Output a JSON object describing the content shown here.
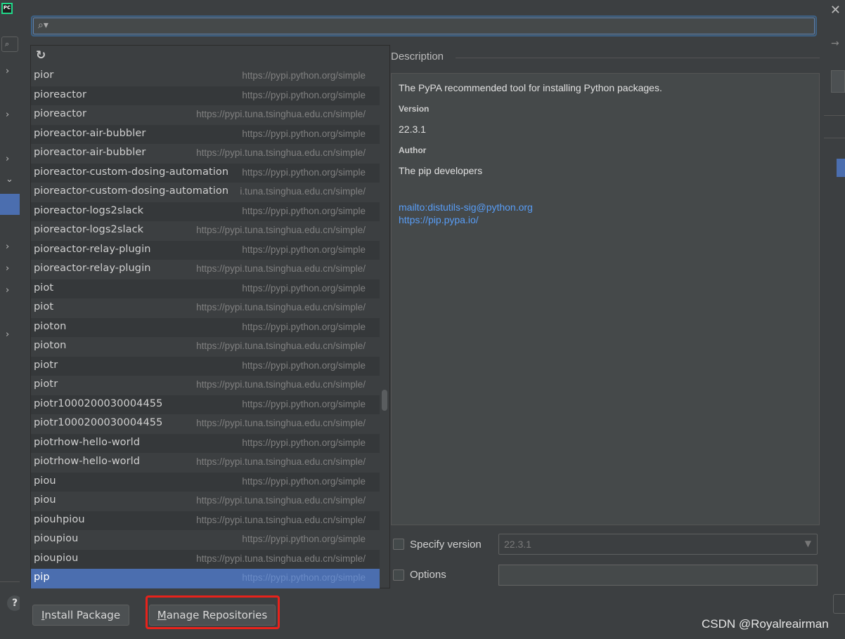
{
  "search": {
    "value": "",
    "icon": "search-icon"
  },
  "toolbar": {
    "refresh_icon": "refresh-icon"
  },
  "packages": [
    {
      "name": "pior",
      "repo": "https://pypi.python.org/simple"
    },
    {
      "name": "pioreactor",
      "repo": "https://pypi.python.org/simple"
    },
    {
      "name": "pioreactor",
      "repo": "https://pypi.tuna.tsinghua.edu.cn/simple/"
    },
    {
      "name": "pioreactor-air-bubbler",
      "repo": "https://pypi.python.org/simple"
    },
    {
      "name": "pioreactor-air-bubbler",
      "repo": "https://pypi.tuna.tsinghua.edu.cn/simple/"
    },
    {
      "name": "pioreactor-custom-dosing-automation",
      "repo": "https://pypi.python.org/simple"
    },
    {
      "name": "pioreactor-custom-dosing-automation",
      "repo": "i.tuna.tsinghua.edu.cn/simple/"
    },
    {
      "name": "pioreactor-logs2slack",
      "repo": "https://pypi.python.org/simple"
    },
    {
      "name": "pioreactor-logs2slack",
      "repo": "https://pypi.tuna.tsinghua.edu.cn/simple/"
    },
    {
      "name": "pioreactor-relay-plugin",
      "repo": "https://pypi.python.org/simple"
    },
    {
      "name": "pioreactor-relay-plugin",
      "repo": "https://pypi.tuna.tsinghua.edu.cn/simple/"
    },
    {
      "name": "piot",
      "repo": "https://pypi.python.org/simple"
    },
    {
      "name": "piot",
      "repo": "https://pypi.tuna.tsinghua.edu.cn/simple/"
    },
    {
      "name": "pioton",
      "repo": "https://pypi.python.org/simple"
    },
    {
      "name": "pioton",
      "repo": "https://pypi.tuna.tsinghua.edu.cn/simple/"
    },
    {
      "name": "piotr",
      "repo": "https://pypi.python.org/simple"
    },
    {
      "name": "piotr",
      "repo": "https://pypi.tuna.tsinghua.edu.cn/simple/"
    },
    {
      "name": "piotr1000200030004455",
      "repo": "https://pypi.python.org/simple"
    },
    {
      "name": "piotr1000200030004455",
      "repo": "https://pypi.tuna.tsinghua.edu.cn/simple/"
    },
    {
      "name": "piotrhow-hello-world",
      "repo": "https://pypi.python.org/simple"
    },
    {
      "name": "piotrhow-hello-world",
      "repo": "https://pypi.tuna.tsinghua.edu.cn/simple/"
    },
    {
      "name": "piou",
      "repo": "https://pypi.python.org/simple"
    },
    {
      "name": "piou",
      "repo": "https://pypi.tuna.tsinghua.edu.cn/simple/"
    },
    {
      "name": "piouhpiou",
      "repo": "https://pypi.tuna.tsinghua.edu.cn/simple/"
    },
    {
      "name": "pioupiou",
      "repo": "https://pypi.python.org/simple"
    },
    {
      "name": "pioupiou",
      "repo": "https://pypi.tuna.tsinghua.edu.cn/simple/"
    },
    {
      "name": "pip",
      "repo": "https://pypi.python.org/simple",
      "selected": true
    }
  ],
  "description": {
    "title": "Description",
    "summary": "The PyPA recommended tool for installing Python packages.",
    "version_label": "Version",
    "version": "22.3.1",
    "author_label": "Author",
    "author": "The pip developers",
    "mailto": "mailto:distutils-sig@python.org",
    "homepage": "https://pip.pypa.io/"
  },
  "options": {
    "specify_version_label": "Specify version",
    "specify_version_value": "22.3.1",
    "options_label": "Options",
    "options_value": ""
  },
  "buttons": {
    "install_package": {
      "mnemonic": "I",
      "rest": "nstall Package"
    },
    "manage_repositories": {
      "mnemonic": "M",
      "rest": "anage Repositories"
    }
  },
  "highlight_color": "#e8221b",
  "selection_color": "#4b6eaf",
  "background_ide": {
    "logo_text": "PC",
    "help_label": "?",
    "close_icon": "close-icon"
  },
  "watermark": "CSDN @Royalreairman"
}
